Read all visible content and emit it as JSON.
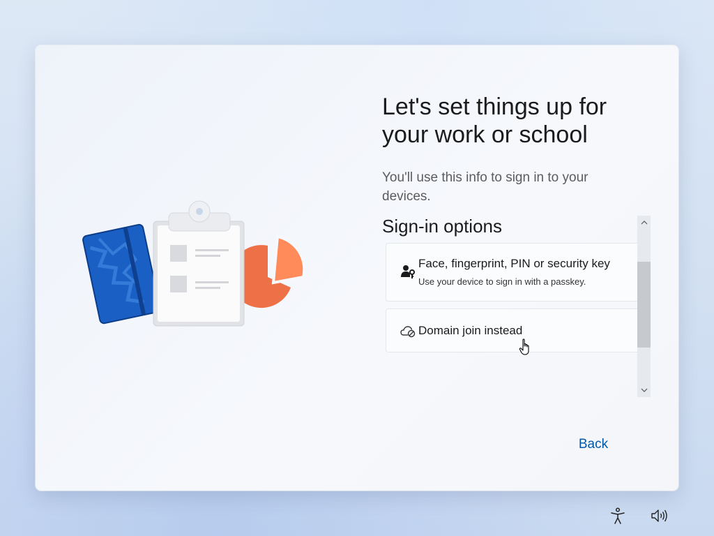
{
  "setup": {
    "title": "Let's set things up for your work or school",
    "subtitle": "You'll use this info to sign in to your devices."
  },
  "sign_in": {
    "section_title": "Sign-in options",
    "options": [
      {
        "icon": "person-key-icon",
        "title": "Face, fingerprint, PIN or security key",
        "description": "Use your device to sign in with a passkey."
      },
      {
        "icon": "cloud-domain-icon",
        "title": "Domain join instead"
      }
    ]
  },
  "navigation": {
    "back_label": "Back"
  },
  "taskbar": {
    "icons": [
      "accessibility-icon",
      "volume-icon"
    ]
  },
  "colors": {
    "accent": "#0059a8",
    "illustration_blue": "#1a5fc4",
    "illustration_orange": "#ee7047"
  }
}
